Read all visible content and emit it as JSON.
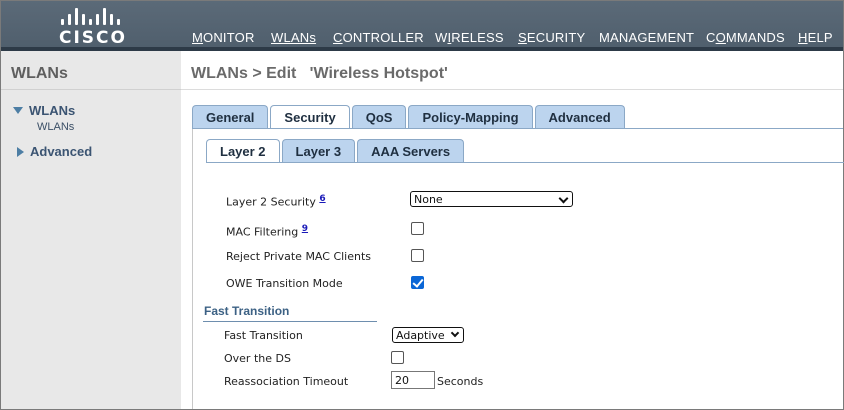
{
  "header": {
    "brand": "CISCO",
    "nav": [
      {
        "label": "MONITOR",
        "ul": "M",
        "rest": "ONITOR"
      },
      {
        "label": "WLANs",
        "ul": "W",
        "rest": "LANs"
      },
      {
        "label": "CONTROLLER",
        "ul": "C",
        "rest": "ONTROLLER"
      },
      {
        "label": "WIRELESS",
        "pre": "W",
        "ul": "I",
        "rest": "RELESS"
      },
      {
        "label": "SECURITY",
        "ul": "S",
        "rest": "ECURITY"
      },
      {
        "label": "MANAGEMENT",
        "ul": "M",
        "pre": "",
        "rest": "ANAGEMENT"
      },
      {
        "label": "COMMANDS",
        "pre": "C",
        "ul": "O",
        "rest": "MMANDS"
      },
      {
        "label": "HELP",
        "ul": "H",
        "rest": "ELP"
      }
    ]
  },
  "sidebar": {
    "title": "WLANs",
    "items": [
      {
        "label": "WLANs",
        "sub": "WLANs"
      },
      {
        "label": "Advanced"
      }
    ]
  },
  "main": {
    "title": "WLANs > Edit   'Wireless Hotspot'",
    "tabs": [
      "General",
      "Security",
      "QoS",
      "Policy-Mapping",
      "Advanced"
    ],
    "active_tab": "Security",
    "subtabs": [
      "Layer 2",
      "Layer 3",
      "AAA Servers"
    ],
    "active_subtab": "Layer 2",
    "fields": {
      "layer2_security": {
        "label": "Layer 2 Security",
        "footnote": "6",
        "value": "None"
      },
      "mac_filtering": {
        "label": "MAC Filtering",
        "footnote": "9",
        "checked": false
      },
      "reject_private_mac": {
        "label": "Reject Private MAC Clients",
        "checked": false
      },
      "owe_transition": {
        "label": "OWE Transition Mode",
        "checked": true
      }
    },
    "fast_transition": {
      "title": "Fast Transition",
      "mode": {
        "label": "Fast Transition",
        "value": "Adaptive"
      },
      "over_ds": {
        "label": "Over the DS",
        "checked": false
      },
      "reassoc_timeout": {
        "label": "Reassociation Timeout",
        "value": "20",
        "unit": "Seconds"
      }
    }
  },
  "colors": {
    "header": "#54636f",
    "tab": "#bcd4ee",
    "sidebar": "#e8e8e8",
    "checkbox_checked": "#0a66d6"
  }
}
